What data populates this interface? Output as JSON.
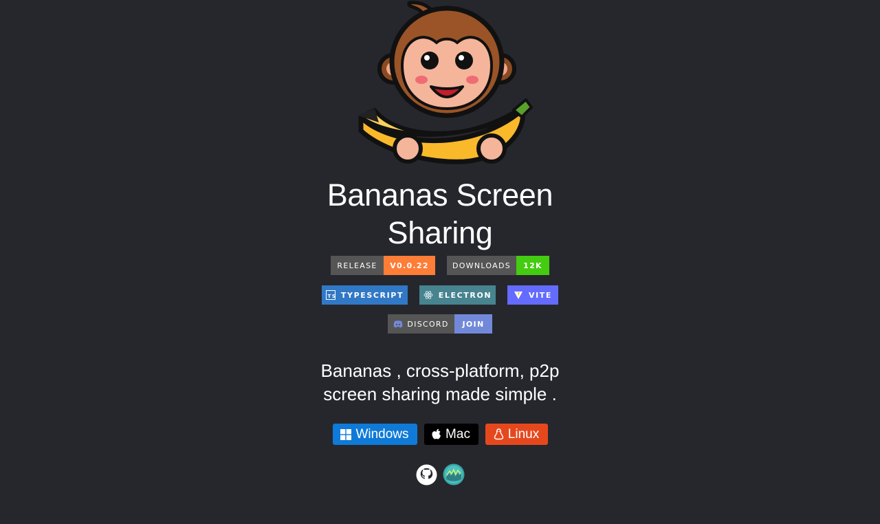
{
  "title": {
    "line1": "Bananas Screen",
    "line2": "Sharing"
  },
  "badges": {
    "release_label": "RELEASE",
    "release_value": "V0.0.22",
    "downloads_label": "DOWNLOADS",
    "downloads_value": "12K",
    "typescript": "TYPESCRIPT",
    "electron": "ELECTRON",
    "vite": "VITE",
    "discord_label": "DISCORD",
    "discord_value": "JOIN"
  },
  "description": {
    "line1": "Bananas , cross-platform, p2p",
    "line2": "screen sharing made simple ."
  },
  "downloads": {
    "windows": "Windows",
    "mac": "Mac",
    "linux": "Linux"
  },
  "links": {
    "github_icon": "github-icon",
    "website_icon": "globe-icon"
  },
  "colors": {
    "background": "#25272d",
    "release": "#fe7d37",
    "downloads": "#44cc11",
    "typescript": "#3178c6",
    "electron": "#47848f",
    "vite": "#646cff",
    "discord": "#7289da",
    "windows": "#0f7ad7",
    "mac": "#000000",
    "linux": "#e6481e"
  }
}
